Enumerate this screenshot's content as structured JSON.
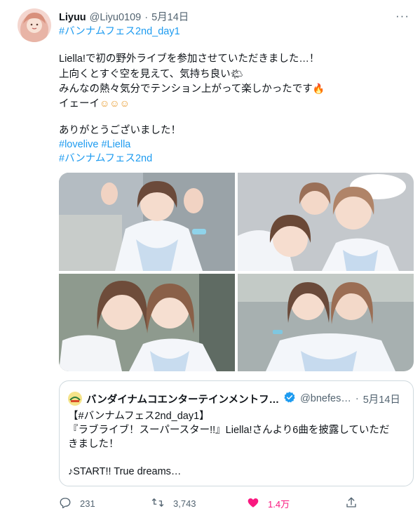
{
  "author": {
    "name": "Liyuu",
    "handle": "@Liyu0109",
    "separator": "·",
    "date": "5月14日"
  },
  "tweet": {
    "hashtag_top": "#バンナムフェス2nd_day1",
    "line1": "Liella!で初の野外ライブを参加させていただきました…！",
    "line2": "上向くとすぐ空を見えて、気持ち良い",
    "line2_emoji": "🌤",
    "line3": "みんなの熱々気分でテンション上がって楽しかったです",
    "line3_emoji": "🔥",
    "line4": "イェーイ",
    "line4_emoji": "☺☺☺",
    "line5": "ありがとうございました！",
    "hashtag_line1a": "#lovelive",
    "hashtag_line1b": "#Liella",
    "hashtag_line2": "#バンナムフェス2nd"
  },
  "quote": {
    "name": "バンダイナムコエンターテインメントフ…",
    "handle": "@bnefes…",
    "separator": "·",
    "date": "5月14日",
    "line1": "【#バンナムフェス2nd_day1】",
    "line2": "『ラブライブ！スーパースター!!』Liella!さんより6曲を披露していただ",
    "line3": "きました！",
    "line4": "♪START!! True dreams…"
  },
  "actions": {
    "replies": "231",
    "retweets": "3,743",
    "likes": "1.4万"
  },
  "colors": {
    "link": "#1d9bf0",
    "like": "#f91880",
    "muted": "#536471",
    "verified": "#1d9bf0"
  }
}
